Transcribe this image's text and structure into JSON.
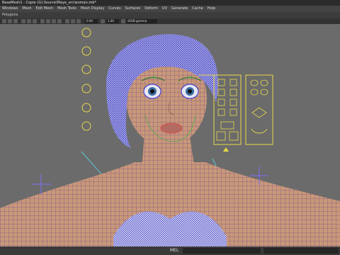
{
  "window": {
    "title": "BaseMesh1 - Copie (G):Source\\Maya_src\\woman.mb*"
  },
  "menubar": {
    "items": [
      "Windows",
      "Mesh",
      "Edit Mesh",
      "Mesh Tools",
      "Mesh Display",
      "Curves",
      "Surfaces",
      "Deform",
      "UV",
      "Generate",
      "Cache",
      "Help"
    ]
  },
  "shelf": {
    "label": "Polygons"
  },
  "panel_toolbar": {
    "field1": "0.00",
    "field2": "1.00",
    "colorspace": "sRGB gamma"
  },
  "commandline": {
    "label": "MEL"
  },
  "colors": {
    "wireframe": "#2e2ed6",
    "controls": "#e8d94a",
    "skin": "#c99878",
    "curves": "#5fc7d9"
  }
}
